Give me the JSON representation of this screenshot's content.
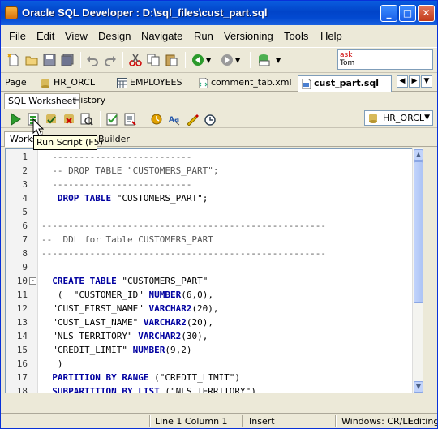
{
  "window": {
    "title": "Oracle SQL Developer : D:\\sql_files\\cust_part.sql"
  },
  "menu": {
    "items": [
      "File",
      "Edit",
      "View",
      "Design",
      "Navigate",
      "Run",
      "Versioning",
      "Tools",
      "Help"
    ]
  },
  "ask": {
    "line1": "ask",
    "line2": "Tom"
  },
  "tabs": [
    {
      "label": "Page",
      "icon": "page-icon"
    },
    {
      "label": "HR_ORCL",
      "icon": "connection-icon"
    },
    {
      "label": "EMPLOYEES",
      "icon": "table-icon"
    },
    {
      "label": "comment_tab.xml",
      "icon": "xml-file-icon"
    },
    {
      "label": "cust_part.sql",
      "icon": "sql-file-icon"
    }
  ],
  "subtabs": [
    "SQL Worksheet",
    "History"
  ],
  "connection": {
    "selected": "HR_ORCL"
  },
  "worktabs": {
    "worksheet": "Works",
    "builder": "Builder"
  },
  "tooltip": "Run Script (F5)",
  "editor": {
    "lines": [
      {
        "n": "1",
        "tokens": [
          {
            "t": "cm",
            "v": "  --------------------------"
          }
        ]
      },
      {
        "n": "2",
        "tokens": [
          {
            "t": "cm",
            "v": "  -- DROP TABLE \"CUSTOMERS_PART\";"
          }
        ]
      },
      {
        "n": "3",
        "tokens": [
          {
            "t": "cm",
            "v": "  --------------------------"
          }
        ]
      },
      {
        "n": "4",
        "tokens": [
          {
            "t": "",
            "v": "   "
          },
          {
            "t": "kw",
            "v": "DROP TABLE"
          },
          {
            "t": "",
            "v": " \"CUSTOMERS_PART\";"
          }
        ]
      },
      {
        "n": "5",
        "tokens": []
      },
      {
        "n": "6",
        "tokens": [
          {
            "t": "cm",
            "v": "-----------------------------------------------------"
          }
        ]
      },
      {
        "n": "7",
        "tokens": [
          {
            "t": "cm",
            "v": "--  DDL for Table CUSTOMERS_PART"
          }
        ]
      },
      {
        "n": "8",
        "tokens": [
          {
            "t": "cm",
            "v": "-----------------------------------------------------"
          }
        ]
      },
      {
        "n": "9",
        "tokens": []
      },
      {
        "n": "10",
        "tokens": [
          {
            "t": "",
            "v": "  "
          },
          {
            "t": "kw",
            "v": "CREATE TABLE"
          },
          {
            "t": "",
            "v": " \"CUSTOMERS_PART\""
          }
        ],
        "fold": "-"
      },
      {
        "n": "11",
        "tokens": [
          {
            "t": "",
            "v": "   (  \"CUSTOMER_ID\" "
          },
          {
            "t": "kw",
            "v": "NUMBER"
          },
          {
            "t": "",
            "v": "(6,0),"
          }
        ]
      },
      {
        "n": "12",
        "tokens": [
          {
            "t": "",
            "v": "  \"CUST_FIRST_NAME\" "
          },
          {
            "t": "kw",
            "v": "VARCHAR2"
          },
          {
            "t": "",
            "v": "(20),"
          }
        ]
      },
      {
        "n": "13",
        "tokens": [
          {
            "t": "",
            "v": "  \"CUST_LAST_NAME\" "
          },
          {
            "t": "kw",
            "v": "VARCHAR2"
          },
          {
            "t": "",
            "v": "(20),"
          }
        ]
      },
      {
        "n": "14",
        "tokens": [
          {
            "t": "",
            "v": "  \"NLS_TERRITORY\" "
          },
          {
            "t": "kw",
            "v": "VARCHAR2"
          },
          {
            "t": "",
            "v": "(30),"
          }
        ]
      },
      {
        "n": "15",
        "tokens": [
          {
            "t": "",
            "v": "  \"CREDIT_LIMIT\" "
          },
          {
            "t": "kw",
            "v": "NUMBER"
          },
          {
            "t": "",
            "v": "(9,2)"
          }
        ]
      },
      {
        "n": "16",
        "tokens": [
          {
            "t": "",
            "v": "   )"
          }
        ]
      },
      {
        "n": "17",
        "tokens": [
          {
            "t": "",
            "v": "  "
          },
          {
            "t": "kw",
            "v": "PARTITION BY RANGE"
          },
          {
            "t": "",
            "v": " (\"CREDIT_LIMIT\")"
          }
        ]
      },
      {
        "n": "18",
        "tokens": [
          {
            "t": "",
            "v": "  "
          },
          {
            "t": "kw",
            "v": "SUBPARTITION BY LIST"
          },
          {
            "t": "",
            "v": " (\"NLS_TERRITORY\")"
          }
        ]
      }
    ]
  },
  "status": {
    "position": "Line 1 Column 1",
    "mode": "Insert",
    "line_endings": "Windows: CR/LF",
    "state": "Editing"
  },
  "colors": {
    "title_bar": "#0144c9",
    "keyword": "#0000a0",
    "comment": "#555555"
  }
}
